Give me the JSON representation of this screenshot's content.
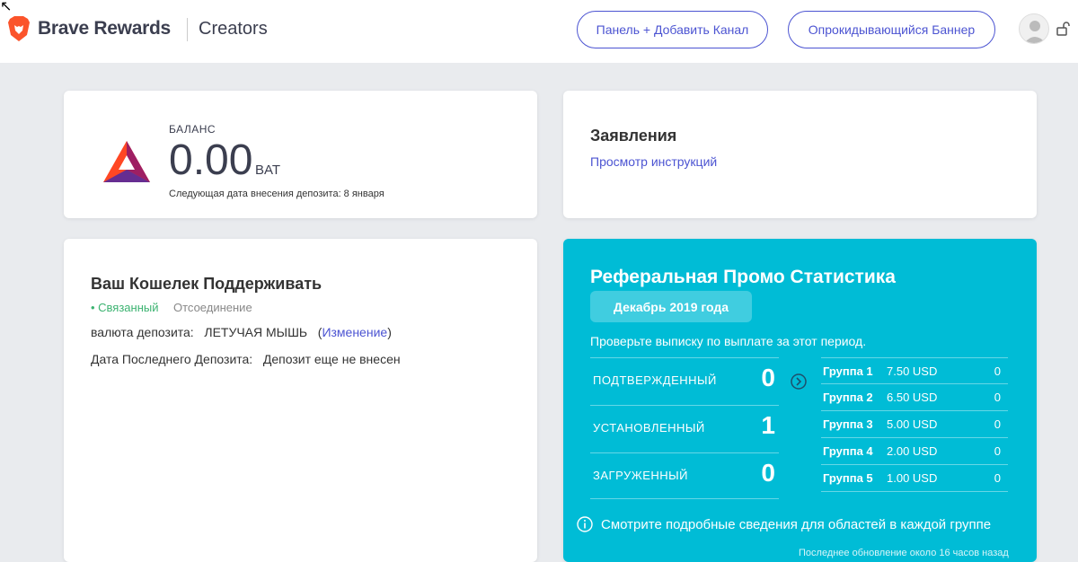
{
  "header": {
    "brand": "Brave Rewards",
    "sub": "Creators",
    "btn_dashboard": "Панель + Добавить Канал",
    "btn_banner": "Опрокидывающийся Баннер"
  },
  "balance": {
    "label": "БАЛАНС",
    "amount": "0.00",
    "unit": "BAT",
    "next_deposit": "Следующая дата внесения депозита: 8 января"
  },
  "statements": {
    "title": "Заявления",
    "link": "Просмотр инструкций"
  },
  "wallet": {
    "title": "Ваш Кошелек Поддерживать",
    "status": "• Связанный",
    "disconnect": "Отсоединение",
    "currency_label": "валюта депозита:",
    "currency_value": "ЛЕТУЧАЯ МЫШЬ",
    "change_open": "(",
    "change_link": "Изменение",
    "change_close": ")",
    "last_label": "Дата Последнего Депозита:",
    "last_value": "Депозит еще не внесен"
  },
  "referral": {
    "title": "Реферальная Промо Статистика",
    "month": "Декабрь 2019 года",
    "check": "Проверьте выписку по выплате за этот период.",
    "stats": [
      {
        "label": "ПОДТВЕРЖДЕННЫЙ",
        "value": "0"
      },
      {
        "label": "УСТАНОВЛЕННЫЙ",
        "value": "1"
      },
      {
        "label": "ЗАГРУЖЕННЫЙ",
        "value": "0"
      }
    ],
    "tiers": [
      {
        "name": "Группа 1",
        "amount": "7.50 USD",
        "count": "0"
      },
      {
        "name": "Группа 2",
        "amount": "6.50 USD",
        "count": "0"
      },
      {
        "name": "Группа 3",
        "amount": "5.00 USD",
        "count": "0"
      },
      {
        "name": "Группа 4",
        "amount": "2.00 USD",
        "count": "0"
      },
      {
        "name": "Группа 5",
        "amount": "1.00 USD",
        "count": "0"
      }
    ],
    "info": "Смотрите подробные сведения для областей в каждой группе",
    "updated": "Последнее обновление около 16 часов назад"
  },
  "colors": {
    "accent": "#4c54d2",
    "referral_bg": "#00bcd6",
    "connected": "#3cb371"
  },
  "icons": [
    "brave-lion-icon",
    "bat-logo-icon",
    "avatar-icon",
    "lock-icon",
    "arrow-right-circle-icon",
    "info-icon"
  ]
}
